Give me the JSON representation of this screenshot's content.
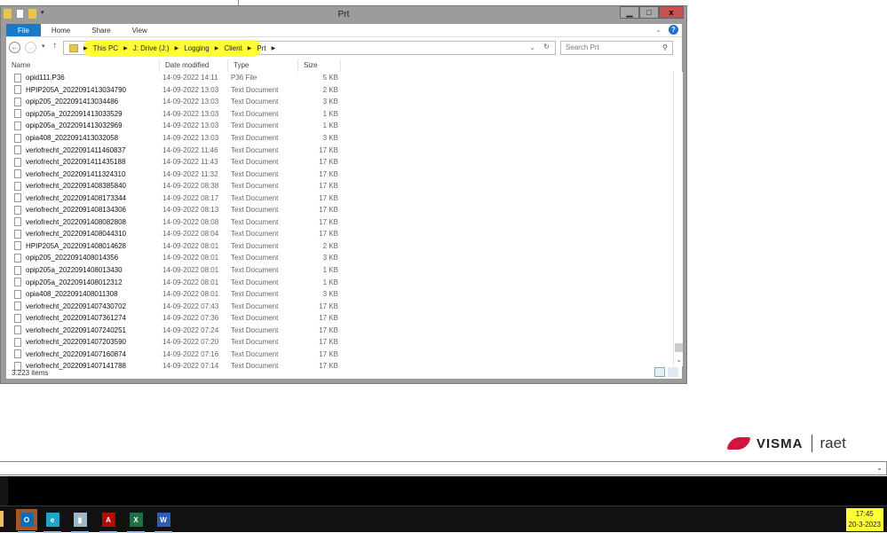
{
  "window": {
    "title": "Prt",
    "minimize": "▁",
    "maximize": "□",
    "close": "x"
  },
  "ribbon": {
    "tabs": [
      "File",
      "Home",
      "Share",
      "View"
    ],
    "expand": "⌄",
    "help": "?"
  },
  "address": {
    "crumbs": [
      "This PC",
      "J: Drive (J:)",
      "Logging",
      "Client",
      "Prt"
    ],
    "highlight_color": "#ffff33"
  },
  "search": {
    "placeholder": "Search Prt"
  },
  "columns": [
    "Name",
    "Date modified",
    "Type",
    "Size"
  ],
  "files": [
    {
      "name": "opid111.P36",
      "date": "14-09-2022 14:11",
      "type": "P36 File",
      "size": "5 KB"
    },
    {
      "name": "HPIP205A_2022091413034790",
      "date": "14-09-2022 13:03",
      "type": "Text Document",
      "size": "2 KB"
    },
    {
      "name": "opip205_2022091413034486",
      "date": "14-09-2022 13:03",
      "type": "Text Document",
      "size": "3 KB"
    },
    {
      "name": "opip205a_2022091413033529",
      "date": "14-09-2022 13:03",
      "type": "Text Document",
      "size": "1 KB"
    },
    {
      "name": "opip205a_2022091413032969",
      "date": "14-09-2022 13:03",
      "type": "Text Document",
      "size": "1 KB"
    },
    {
      "name": "opia408_2022091413032058",
      "date": "14-09-2022 13:03",
      "type": "Text Document",
      "size": "3 KB"
    },
    {
      "name": "verlofrecht_2022091411460837",
      "date": "14-09-2022 11:46",
      "type": "Text Document",
      "size": "17 KB"
    },
    {
      "name": "verlofrecht_2022091411435188",
      "date": "14-09-2022 11:43",
      "type": "Text Document",
      "size": "17 KB"
    },
    {
      "name": "verlofrecht_2022091411324310",
      "date": "14-09-2022 11:32",
      "type": "Text Document",
      "size": "17 KB"
    },
    {
      "name": "verlofrecht_2022091408385840",
      "date": "14-09-2022 08:38",
      "type": "Text Document",
      "size": "17 KB"
    },
    {
      "name": "verlofrecht_2022091408173344",
      "date": "14-09-2022 08:17",
      "type": "Text Document",
      "size": "17 KB"
    },
    {
      "name": "verlofrecht_2022091408134306",
      "date": "14-09-2022 08:13",
      "type": "Text Document",
      "size": "17 KB"
    },
    {
      "name": "verlofrecht_2022091408082808",
      "date": "14-09-2022 08:08",
      "type": "Text Document",
      "size": "17 KB"
    },
    {
      "name": "verlofrecht_2022091408044310",
      "date": "14-09-2022 08:04",
      "type": "Text Document",
      "size": "17 KB"
    },
    {
      "name": "HPIP205A_2022091408014628",
      "date": "14-09-2022 08:01",
      "type": "Text Document",
      "size": "2 KB"
    },
    {
      "name": "opip205_2022091408014356",
      "date": "14-09-2022 08:01",
      "type": "Text Document",
      "size": "3 KB"
    },
    {
      "name": "opip205a_2022091408013430",
      "date": "14-09-2022 08:01",
      "type": "Text Document",
      "size": "1 KB"
    },
    {
      "name": "opip205a_2022091408012312",
      "date": "14-09-2022 08:01",
      "type": "Text Document",
      "size": "1 KB"
    },
    {
      "name": "opia408_2022091408011308",
      "date": "14-09-2022 08:01",
      "type": "Text Document",
      "size": "3 KB"
    },
    {
      "name": "verlofrecht_2022091407430702",
      "date": "14-09-2022 07:43",
      "type": "Text Document",
      "size": "17 KB"
    },
    {
      "name": "verlofrecht_2022091407361274",
      "date": "14-09-2022 07:36",
      "type": "Text Document",
      "size": "17 KB"
    },
    {
      "name": "verlofrecht_2022091407240251",
      "date": "14-09-2022 07:24",
      "type": "Text Document",
      "size": "17 KB"
    },
    {
      "name": "verlofrecht_2022091407203590",
      "date": "14-09-2022 07:20",
      "type": "Text Document",
      "size": "17 KB"
    },
    {
      "name": "verlofrecht_2022091407160874",
      "date": "14-09-2022 07:16",
      "type": "Text Document",
      "size": "17 KB"
    },
    {
      "name": "verlofrecht_2022091407141788",
      "date": "14-09-2022 07:14",
      "type": "Text Document",
      "size": "17 KB"
    }
  ],
  "status": {
    "items": "3.223 items"
  },
  "brand": {
    "name": "VISMA",
    "sub": "raet",
    "color": "#d0163c"
  },
  "taskbar": {
    "apps": [
      {
        "name": "outlook",
        "glyph": "O",
        "color": "#0f6cbd"
      },
      {
        "name": "edge",
        "glyph": "e",
        "color": "#1da6c9"
      },
      {
        "name": "notes",
        "glyph": "▮",
        "color": "#9bb7c9"
      },
      {
        "name": "acrobat",
        "glyph": "A",
        "color": "#b30b00"
      },
      {
        "name": "excel",
        "glyph": "X",
        "color": "#1d7044"
      },
      {
        "name": "word",
        "glyph": "W",
        "color": "#2b5fb4"
      }
    ],
    "time": "17:45",
    "date": "20-3-2023"
  }
}
